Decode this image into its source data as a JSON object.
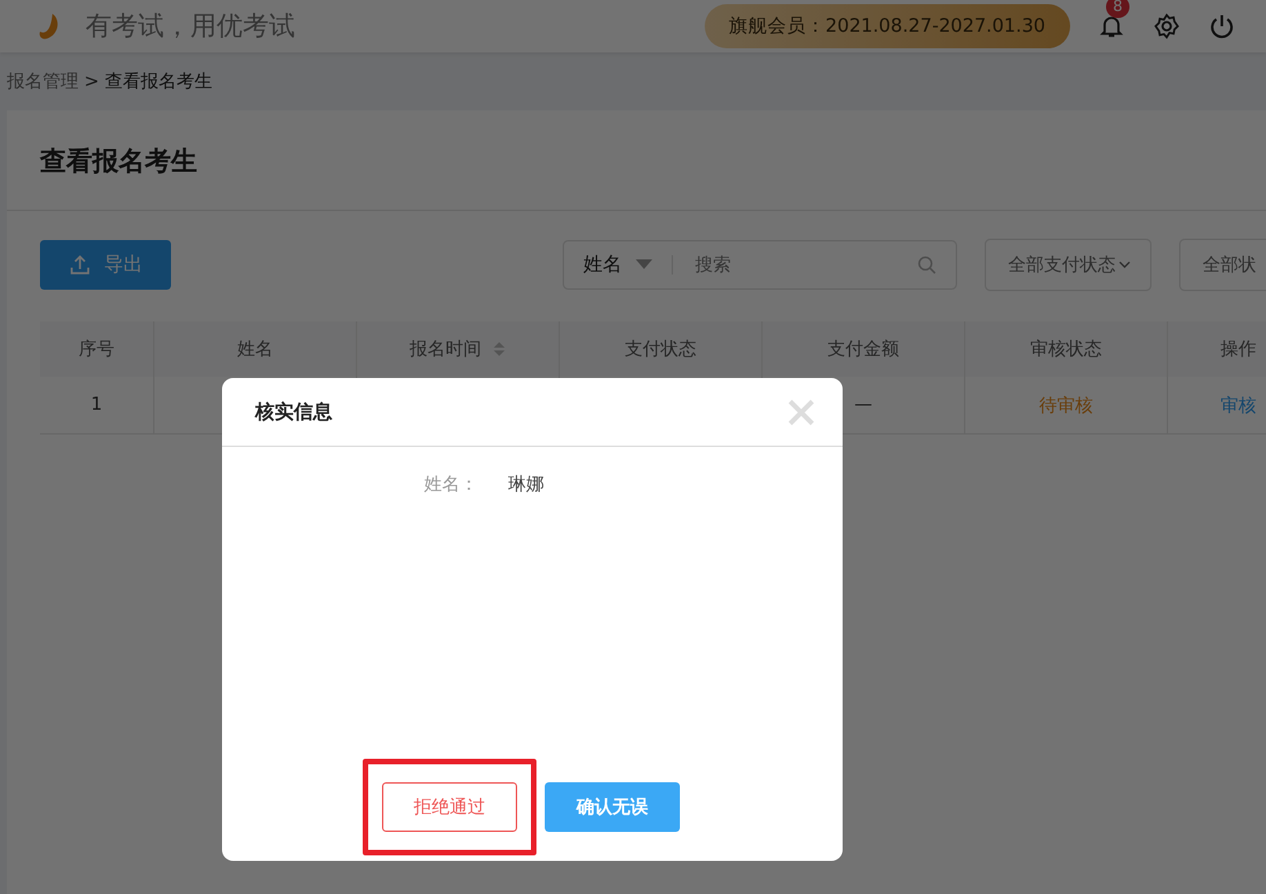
{
  "header": {
    "slogan": "有考试，用优考试",
    "membership": "旗舰会员：2021.08.27-2027.01.30",
    "notification_count": "8"
  },
  "breadcrumb": {
    "items": [
      "报名管理",
      "查看报名考生"
    ],
    "separator": ">"
  },
  "page_title": "查看报名考生",
  "toolbar": {
    "export_button": "导出",
    "search": {
      "field": "姓名",
      "placeholder": "搜索"
    },
    "filters": [
      {
        "label": "全部支付状态",
        "chevron": true
      },
      {
        "label": "全部状",
        "chevron": false
      }
    ]
  },
  "table": {
    "columns": [
      {
        "label": "序号",
        "sortable": false
      },
      {
        "label": "姓名",
        "sortable": false
      },
      {
        "label": "报名时间",
        "sortable": true
      },
      {
        "label": "支付状态",
        "sortable": false
      },
      {
        "label": "支付金额",
        "sortable": false
      },
      {
        "label": "审核状态",
        "sortable": false
      },
      {
        "label": "操作",
        "sortable": false
      }
    ],
    "rows": [
      {
        "index": "1",
        "amount": "—",
        "review_status": "待审核",
        "action": "审核"
      }
    ]
  },
  "dialog": {
    "title": "核实信息",
    "fields": [
      {
        "label": "姓名：",
        "value": "琳娜"
      }
    ],
    "buttons": [
      {
        "label": "拒绝通过",
        "kind": "reject",
        "highlighted": true
      },
      {
        "label": "确认无误",
        "kind": "confirm",
        "highlighted": false
      }
    ]
  }
}
